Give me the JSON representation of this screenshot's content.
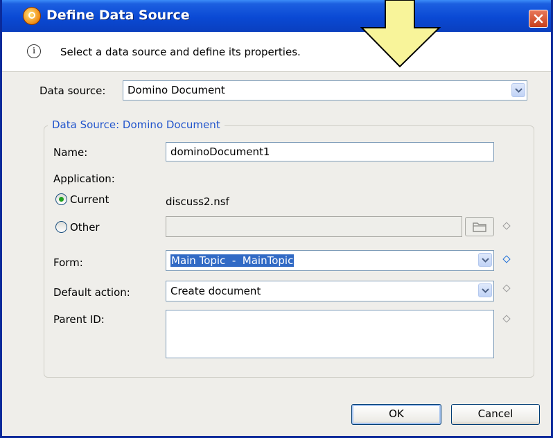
{
  "window": {
    "title": "Define Data Source",
    "info_text": "Select a data source and define its properties."
  },
  "data_source": {
    "label": "Data source:",
    "value": "Domino Document"
  },
  "group": {
    "title": "Data Source: Domino Document",
    "name_label": "Name:",
    "name_value": "dominoDocument1",
    "application_label": "Application:",
    "current_label": "Current",
    "current_value": "discuss2.nsf",
    "current_checked": true,
    "other_label": "Other",
    "other_value": "",
    "form_label": "Form:",
    "form_value": "Main Topic  -  MainTopic",
    "default_action_label": "Default action:",
    "default_action_value": "Create document",
    "parent_id_label": "Parent ID:",
    "parent_id_value": ""
  },
  "buttons": {
    "ok": "OK",
    "cancel": "Cancel"
  },
  "colors": {
    "titlebar": "#0a49d4",
    "arrow": "#f8f49a",
    "selection": "#316ac5",
    "group_title": "#2255cc"
  }
}
